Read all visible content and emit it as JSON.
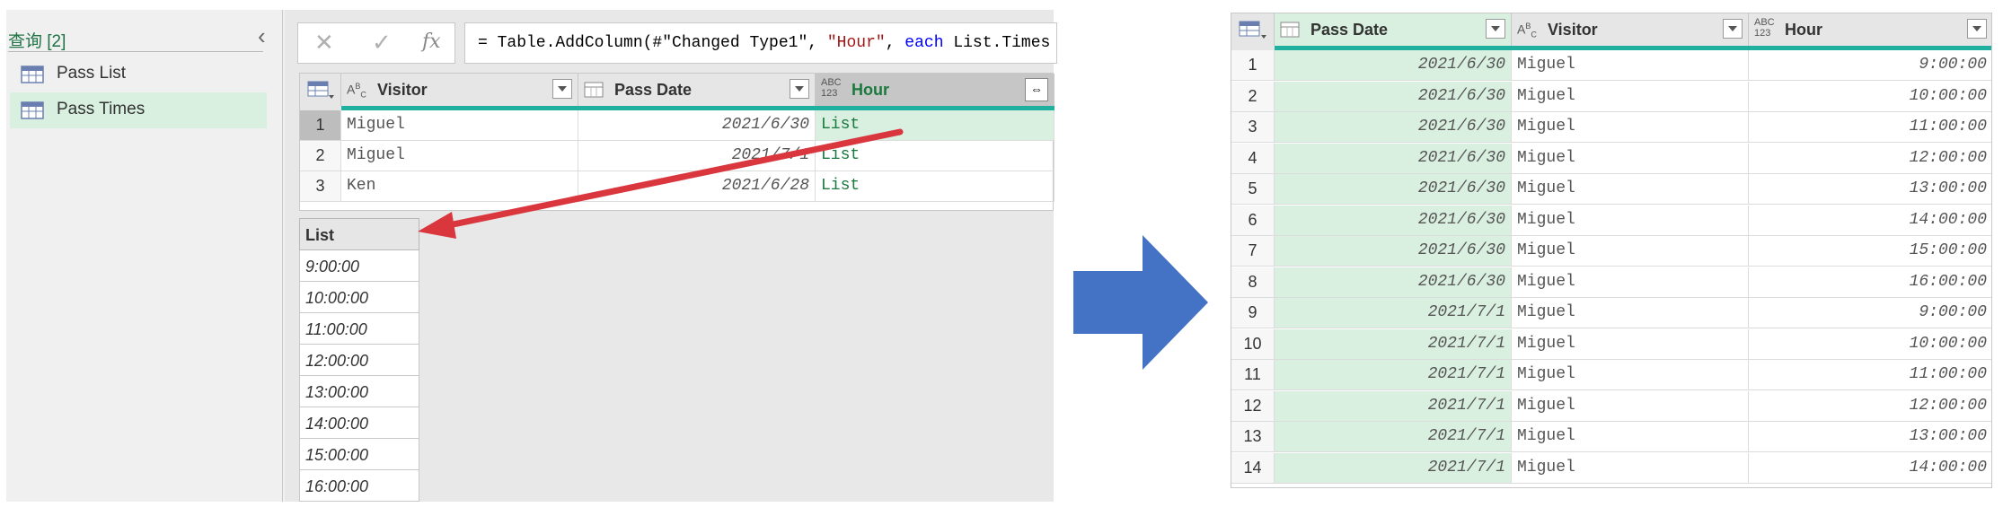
{
  "queries": {
    "header": "查询 [2]",
    "items": [
      {
        "label": "Pass List",
        "selected": false
      },
      {
        "label": "Pass Times",
        "selected": true
      }
    ]
  },
  "formula": {
    "fx": "fx",
    "prefix": "= Table.AddColumn(#\"Changed Type1\", ",
    "str1": "\"Hour\"",
    "mid": ", ",
    "kw": "each",
    "suffix": " List.Times"
  },
  "top_table": {
    "columns": [
      {
        "type": "ABC",
        "label": "Visitor"
      },
      {
        "type": "date",
        "label": "Pass Date"
      },
      {
        "type": "ABC123",
        "label": "Hour"
      }
    ],
    "rows": [
      {
        "n": "1",
        "visitor": "Miguel",
        "date": "2021/6/30",
        "hour": "List"
      },
      {
        "n": "2",
        "visitor": "Miguel",
        "date": "2021/7/1",
        "hour": "List"
      },
      {
        "n": "3",
        "visitor": "Ken",
        "date": "2021/6/28",
        "hour": "List"
      }
    ]
  },
  "list_preview": {
    "header": "List",
    "items": [
      "9:00:00",
      "10:00:00",
      "11:00:00",
      "12:00:00",
      "13:00:00",
      "14:00:00",
      "15:00:00",
      "16:00:00"
    ]
  },
  "result_table": {
    "columns": [
      {
        "type": "date",
        "label": "Pass Date"
      },
      {
        "type": "ABC",
        "label": "Visitor"
      },
      {
        "type": "ABC123",
        "label": "Hour"
      }
    ],
    "rows": [
      {
        "n": "1",
        "date": "2021/6/30",
        "visitor": "Miguel",
        "hour": "9:00:00"
      },
      {
        "n": "2",
        "date": "2021/6/30",
        "visitor": "Miguel",
        "hour": "10:00:00"
      },
      {
        "n": "3",
        "date": "2021/6/30",
        "visitor": "Miguel",
        "hour": "11:00:00"
      },
      {
        "n": "4",
        "date": "2021/6/30",
        "visitor": "Miguel",
        "hour": "12:00:00"
      },
      {
        "n": "5",
        "date": "2021/6/30",
        "visitor": "Miguel",
        "hour": "13:00:00"
      },
      {
        "n": "6",
        "date": "2021/6/30",
        "visitor": "Miguel",
        "hour": "14:00:00"
      },
      {
        "n": "7",
        "date": "2021/6/30",
        "visitor": "Miguel",
        "hour": "15:00:00"
      },
      {
        "n": "8",
        "date": "2021/6/30",
        "visitor": "Miguel",
        "hour": "16:00:00"
      },
      {
        "n": "9",
        "date": "2021/7/1",
        "visitor": "Miguel",
        "hour": "9:00:00"
      },
      {
        "n": "10",
        "date": "2021/7/1",
        "visitor": "Miguel",
        "hour": "10:00:00"
      },
      {
        "n": "11",
        "date": "2021/7/1",
        "visitor": "Miguel",
        "hour": "11:00:00"
      },
      {
        "n": "12",
        "date": "2021/7/1",
        "visitor": "Miguel",
        "hour": "12:00:00"
      },
      {
        "n": "13",
        "date": "2021/7/1",
        "visitor": "Miguel",
        "hour": "13:00:00"
      },
      {
        "n": "14",
        "date": "2021/7/1",
        "visitor": "Miguel",
        "hour": "14:00:00"
      }
    ]
  },
  "colors": {
    "accent_green": "#217346",
    "selection_green": "#d9efdf",
    "teal_bar": "#20b0a0",
    "arrow_red": "#d9363e",
    "arrow_blue": "#4472c4"
  }
}
